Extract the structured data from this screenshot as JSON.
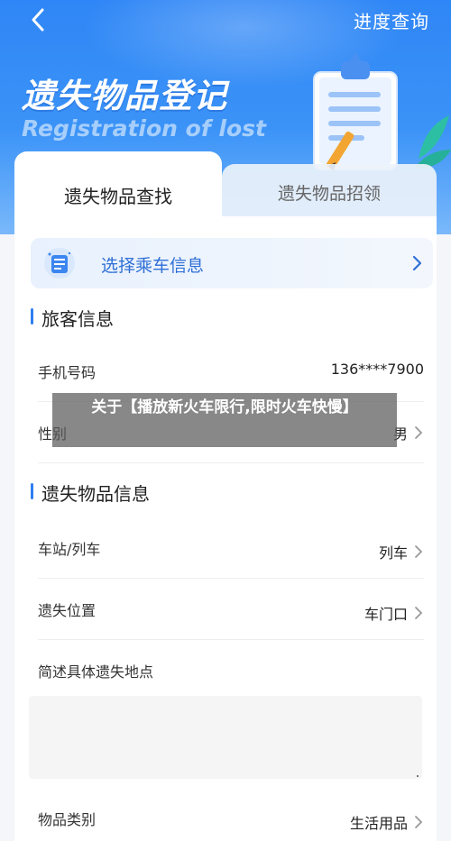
{
  "nav": {
    "progress_link": "进度查询"
  },
  "hero": {
    "title": "遗失物品登记",
    "subtitle": "Registration of lost"
  },
  "tabs": [
    {
      "label": "遗失物品查找",
      "active": true
    },
    {
      "label": "遗失物品招领",
      "active": false
    }
  ],
  "trip_select": {
    "label": "选择乘车信息"
  },
  "passenger_section": {
    "title": "旅客信息",
    "rows": [
      {
        "label": "手机号码",
        "value": "136****7900"
      },
      {
        "label": "性别",
        "value": "男"
      }
    ]
  },
  "item_section": {
    "title": "遗失物品信息",
    "rows": [
      {
        "label": "车站/列车",
        "value": "列车"
      },
      {
        "label": "遗失位置",
        "value": "车门口"
      },
      {
        "label": "简述具体遗失地点",
        "value": ""
      },
      {
        "label": "物品类别",
        "value": "生活用品"
      }
    ]
  },
  "overlay_caption": "关于【播放新火车限行,限时火车快慢】",
  "colors": {
    "primary": "#2f86f6",
    "accent_text": "#2f6fd6"
  }
}
